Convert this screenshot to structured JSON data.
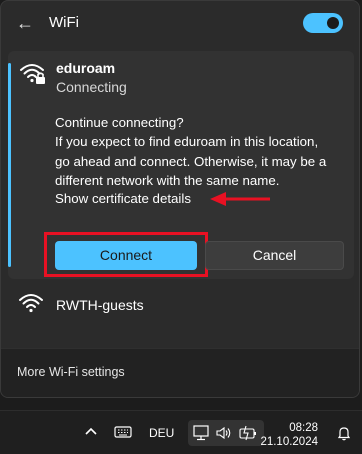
{
  "header": {
    "title": "WiFi",
    "toggle_state": "on"
  },
  "active_network": {
    "name": "eduroam",
    "status": "Connecting",
    "prompt_lines": [
      "Continue connecting?",
      "If you expect to find eduroam in this location,",
      "go ahead and connect. Otherwise, it may be a",
      "different network with the same name."
    ],
    "cert_link": "Show certificate details",
    "connect_label": "Connect",
    "cancel_label": "Cancel"
  },
  "networks": [
    {
      "name": "RWTH-guests"
    }
  ],
  "footer": {
    "more_settings": "More Wi-Fi settings"
  },
  "taskbar": {
    "language": "DEU",
    "time": "08:28",
    "date": "21.10.2024"
  },
  "colors": {
    "accent": "#4cc2ff",
    "annotation_red": "#e81123",
    "panel_bg": "#2b2b2b",
    "card_bg": "#323232"
  },
  "icons": [
    "back-arrow-icon",
    "wifi-secured-icon",
    "wifi-icon",
    "chevron-up-icon",
    "keyboard-icon",
    "network-display-icon",
    "speaker-icon",
    "battery-icon",
    "notification-bell-icon"
  ]
}
